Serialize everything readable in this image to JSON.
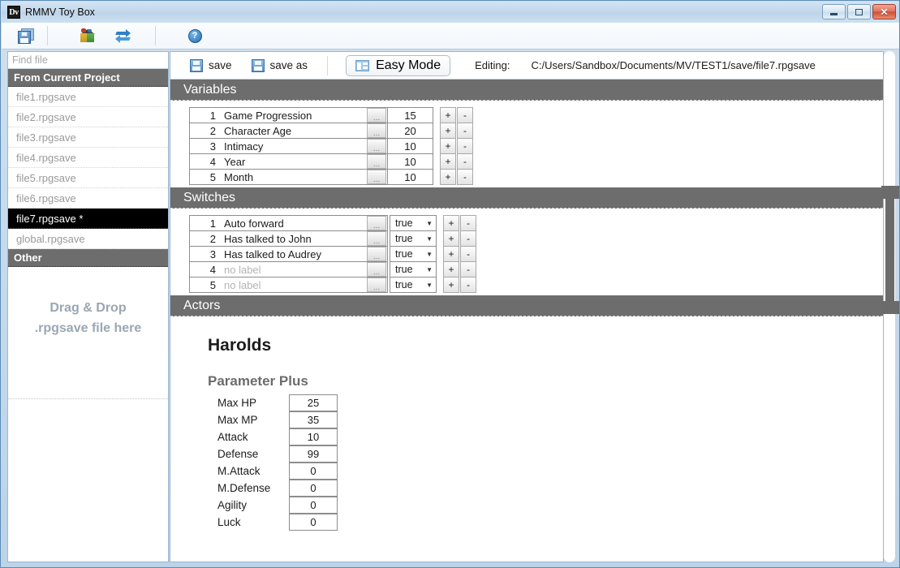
{
  "window": {
    "title": "RMMV Toy Box",
    "app_icon": "Dv",
    "minimize_label": "Minimize",
    "maximize_label": "Maximize",
    "close_label": "Close"
  },
  "toolbar": {
    "items": [
      {
        "name": "save-all-icon",
        "glyph": "floppy"
      },
      {
        "name": "package-icon",
        "glyph": "cube"
      },
      {
        "name": "refresh-icon",
        "glyph": "sync"
      },
      {
        "name": "help-icon",
        "glyph": "question",
        "label": "?"
      }
    ]
  },
  "sidebar": {
    "search": {
      "placeholder": "Find file",
      "value": ""
    },
    "groups": [
      {
        "label": "From Current Project",
        "files": [
          {
            "label": "file1.rpgsave",
            "active": false
          },
          {
            "label": "file2.rpgsave",
            "active": false
          },
          {
            "label": "file3.rpgsave",
            "active": false
          },
          {
            "label": "file4.rpgsave",
            "active": false
          },
          {
            "label": "file5.rpgsave",
            "active": false
          },
          {
            "label": "file6.rpgsave",
            "active": false
          },
          {
            "label": "file7.rpgsave *",
            "active": true
          },
          {
            "label": "global.rpgsave",
            "active": false
          }
        ]
      },
      {
        "label": "Other",
        "files": []
      }
    ],
    "dragdrop_line1": "Drag & Drop",
    "dragdrop_line2": ".rpgsave file here"
  },
  "topbar": {
    "save_label": "save",
    "save_as_label": "save as",
    "mode_button_label": "Easy Mode",
    "editing_label": "Editing:",
    "editing_path": "C:/Users/Sandbox/Documents/MV/TEST1/save/file7.rpgsave"
  },
  "sections": {
    "variables": {
      "title": "Variables",
      "dots_label": "...",
      "plus_label": "+",
      "minus_label": "-",
      "rows": [
        {
          "id": "1",
          "name": "Game Progression",
          "value": "15",
          "empty": false
        },
        {
          "id": "2",
          "name": "Character Age",
          "value": "20",
          "empty": false
        },
        {
          "id": "3",
          "name": "Intimacy",
          "value": "10",
          "empty": false
        },
        {
          "id": "4",
          "name": "Year",
          "value": "10",
          "empty": false
        },
        {
          "id": "5",
          "name": "Month",
          "value": "10",
          "empty": false
        }
      ]
    },
    "switches": {
      "title": "Switches",
      "dots_label": "...",
      "plus_label": "+",
      "minus_label": "-",
      "caret": "▼",
      "rows": [
        {
          "id": "1",
          "name": "Auto forward",
          "value": "true",
          "empty": false
        },
        {
          "id": "2",
          "name": "Has talked to John",
          "value": "true",
          "empty": false
        },
        {
          "id": "3",
          "name": "Has talked to Audrey",
          "value": "true",
          "empty": false
        },
        {
          "id": "4",
          "name": "no label",
          "value": "true",
          "empty": true
        },
        {
          "id": "5",
          "name": "no label",
          "value": "true",
          "empty": true
        }
      ]
    },
    "actors": {
      "title": "Actors",
      "actor_name": "Harolds",
      "param_plus_title": "Parameter Plus",
      "params": [
        {
          "label": "Max HP",
          "value": "25"
        },
        {
          "label": "Max MP",
          "value": "35"
        },
        {
          "label": "Attack",
          "value": "10"
        },
        {
          "label": "Defense",
          "value": "99"
        },
        {
          "label": "M.Attack",
          "value": "0"
        },
        {
          "label": "M.Defense",
          "value": "0"
        },
        {
          "label": "Agility",
          "value": "0"
        },
        {
          "label": "Luck",
          "value": "0"
        }
      ]
    }
  },
  "colors": {
    "section_header_bg": "#6d6d6d",
    "active_file_bg": "#000000",
    "window_chrome": "#bcd3e8",
    "accent_blue": "#3a7fc1"
  }
}
